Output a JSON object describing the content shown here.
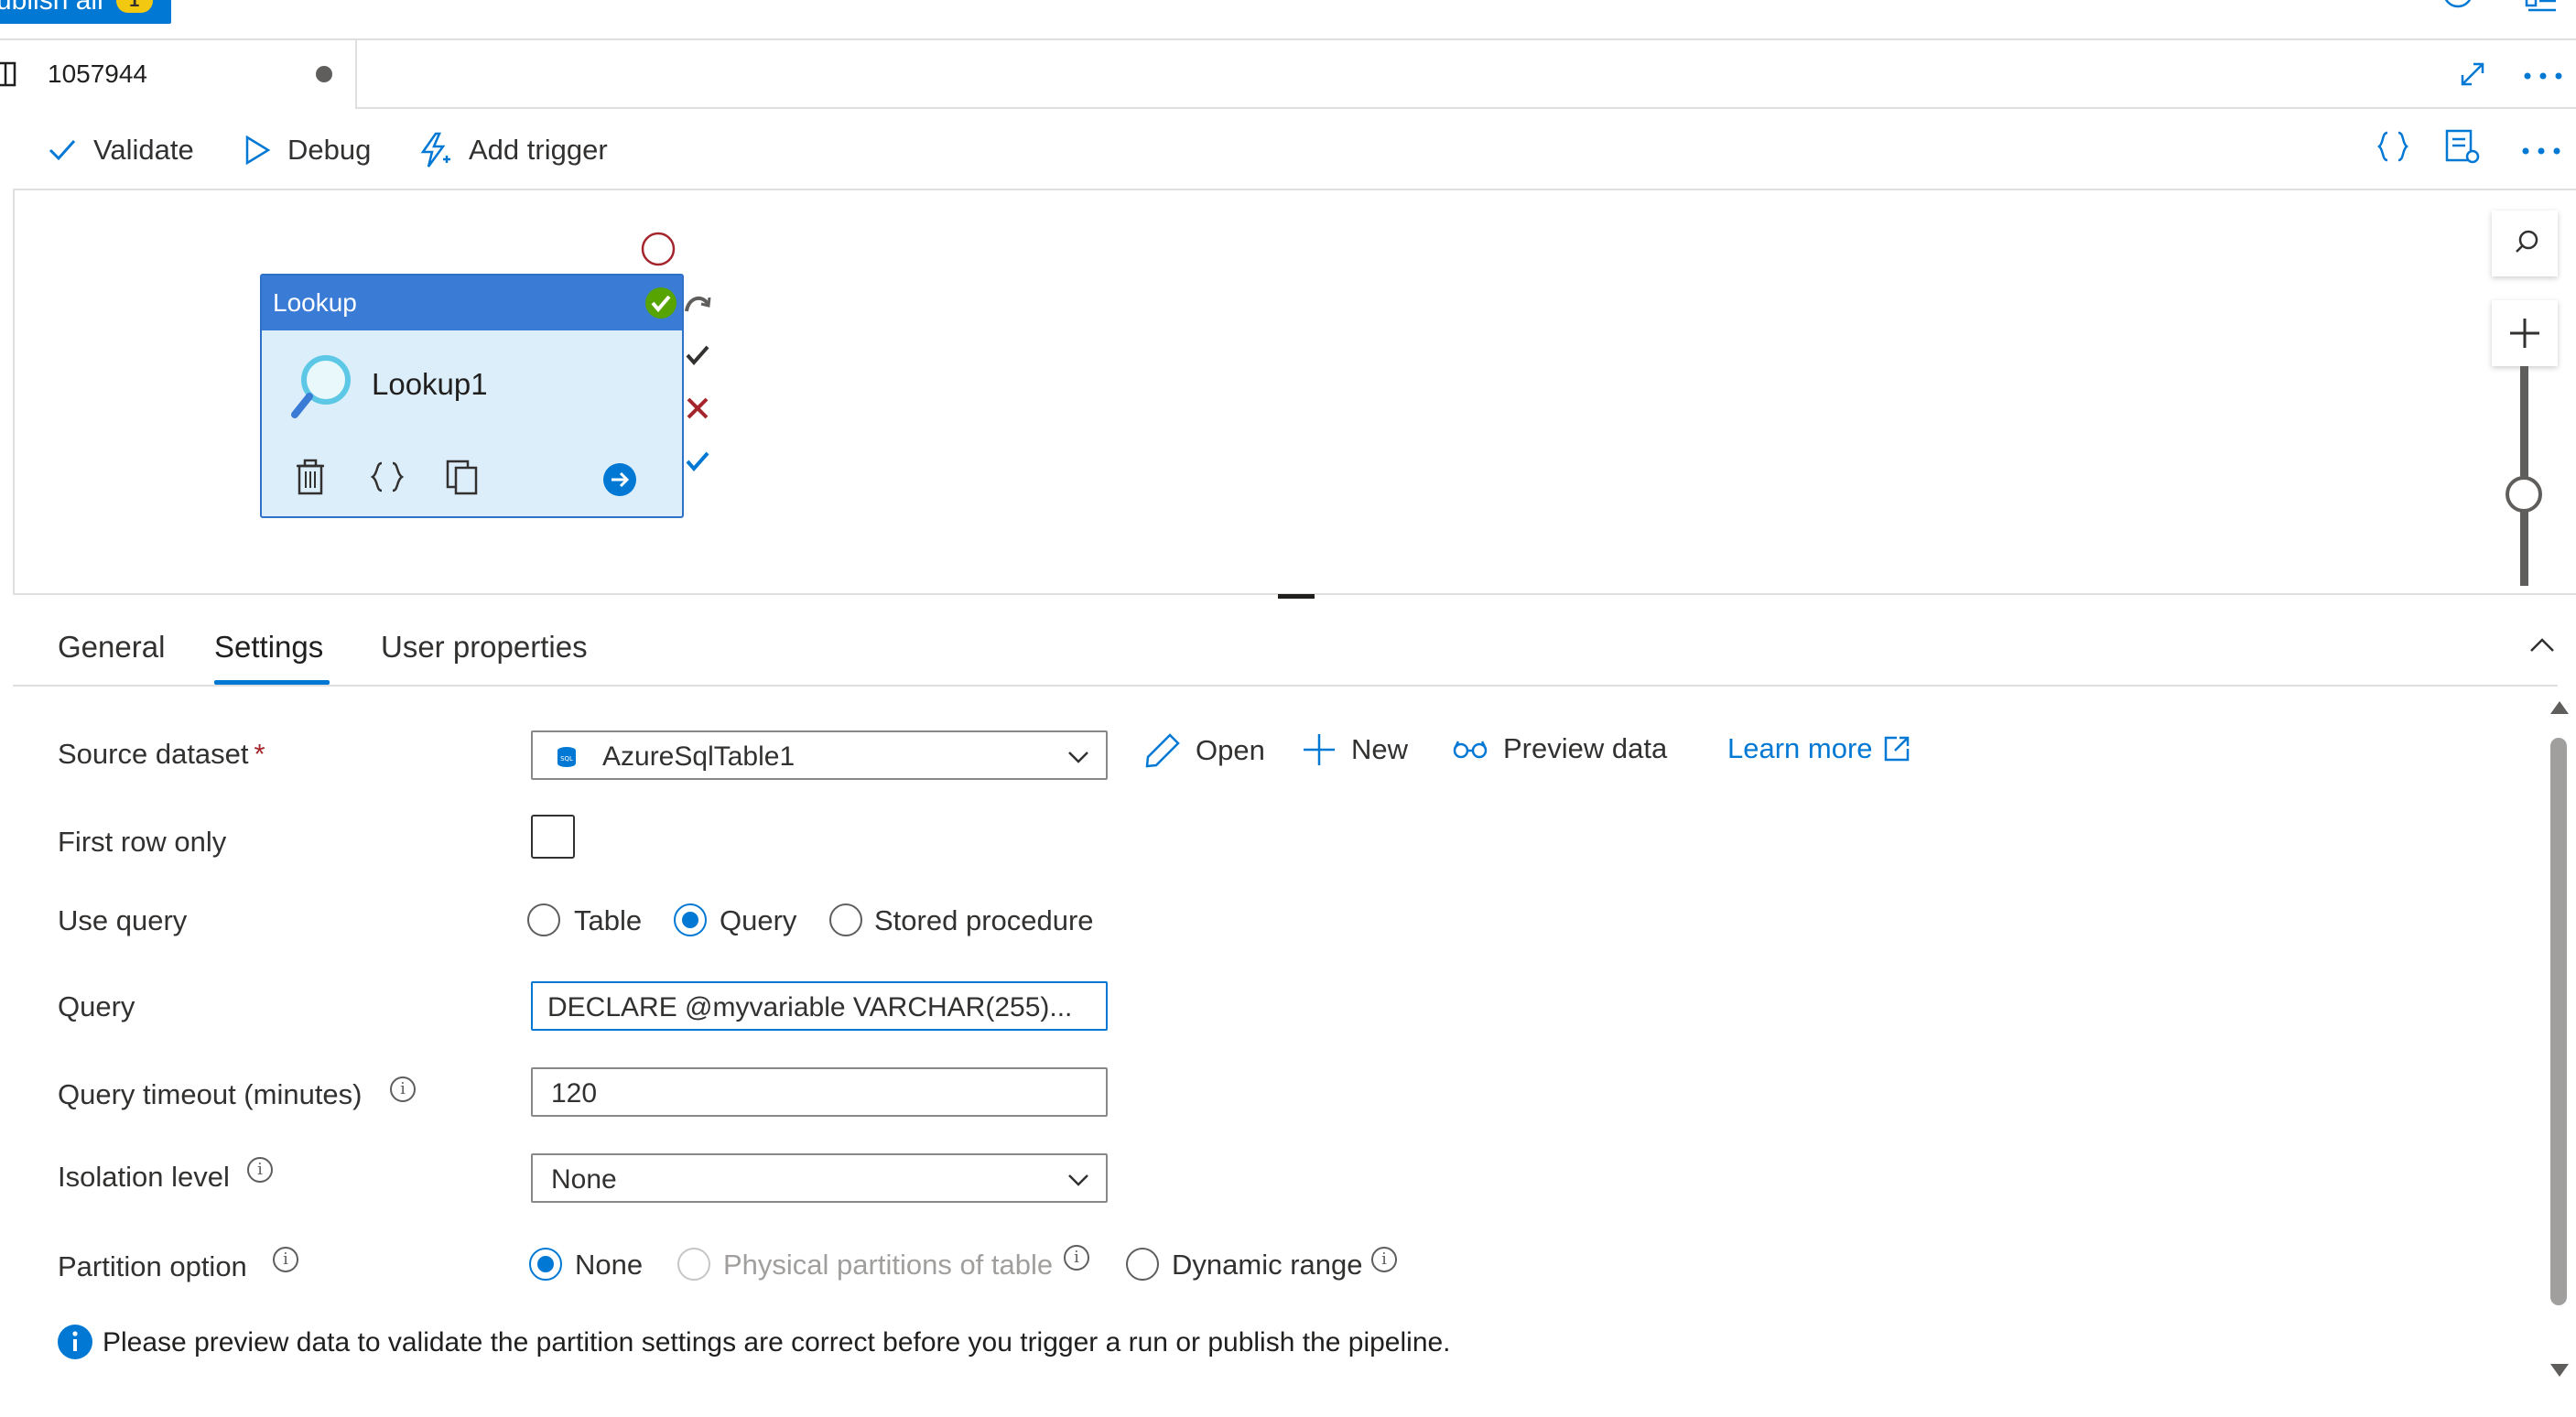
{
  "header": {
    "publish_label": "ublish all",
    "publish_badge": "1"
  },
  "editor_tab": {
    "name": "1057944"
  },
  "toolbar": {
    "validate_label": "Validate",
    "debug_label": "Debug",
    "add_trigger_label": "Add trigger"
  },
  "activity": {
    "type": "Lookup",
    "name": "Lookup1"
  },
  "panel": {
    "tabs": [
      {
        "label": "General",
        "active": false
      },
      {
        "label": "Settings",
        "active": true
      },
      {
        "label": "User properties",
        "active": false
      }
    ]
  },
  "settings": {
    "source_dataset": {
      "label": "Source dataset",
      "required_mark": "*",
      "value": "AzureSqlTable1",
      "open_label": "Open",
      "new_label": "New",
      "preview_label": "Preview data",
      "learn_more_label": "Learn more"
    },
    "first_row_only": {
      "label": "First row only",
      "checked": false
    },
    "use_query": {
      "label": "Use query",
      "options": [
        "Table",
        "Query",
        "Stored procedure"
      ],
      "selected": "Query"
    },
    "query": {
      "label": "Query",
      "value": "DECLARE @myvariable VARCHAR(255)..."
    },
    "query_timeout": {
      "label": "Query timeout (minutes)",
      "value": "120"
    },
    "isolation_level": {
      "label": "Isolation level",
      "value": "None"
    },
    "partition_option": {
      "label": "Partition option",
      "options": [
        "None",
        "Physical partitions of table",
        "Dynamic range"
      ],
      "selected": "None",
      "disabled": [
        "Physical partitions of table"
      ]
    },
    "info_message": "Please preview data to validate the partition settings are correct before you trigger a run or publish the pipeline."
  },
  "colors": {
    "accent": "#0078d4",
    "node_header": "#3a7bd5",
    "node_body": "#ddeefb",
    "success": "#57a300",
    "failure": "#a4262c"
  }
}
